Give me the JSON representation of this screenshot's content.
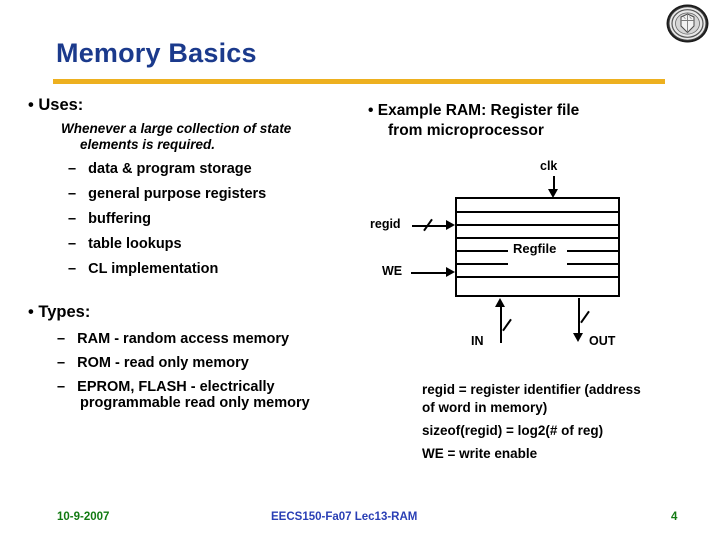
{
  "slide": {
    "title": "Memory Basics",
    "title_color": "#1b3a8c",
    "rule_color": "#edb01f",
    "logo_name": "uc-berkeley-seal"
  },
  "left_column": {
    "section1": {
      "bullet": "• Uses:",
      "italic_note_line1": "Whenever a large collection of state",
      "italic_note_line2": "elements is required.",
      "items": [
        "–   data & program storage",
        "–   general purpose registers",
        "–   buffering",
        "–   table lookups",
        "–   CL implementation"
      ]
    },
    "section2": {
      "bullet": "• Types:",
      "items_line1": "–   RAM - random access memory",
      "items_line2": "–   ROM - read only memory",
      "items_line3": "–   EPROM, FLASH - electrically",
      "items_line4": "programmable read only memory"
    }
  },
  "right_column": {
    "heading_line1": "• Example RAM: Register file",
    "heading_line2": "from microprocessor",
    "diagram": {
      "clk_label": "clk",
      "regid_label": "regid",
      "we_label": "WE",
      "box_label": "Regfile",
      "in_label": "IN",
      "out_label": "OUT"
    },
    "legend": {
      "line1": "regid = register identifier (address",
      "line2": "of word in memory)",
      "line3": "sizeof(regid) = log2(# of reg)",
      "line4": "WE = write enable"
    }
  },
  "footer": {
    "date": "10-9-2007",
    "course": "EECS150-Fa07 Lec13-RAM",
    "page": "4",
    "date_color": "#127a12",
    "course_color": "#2a3fb5"
  }
}
